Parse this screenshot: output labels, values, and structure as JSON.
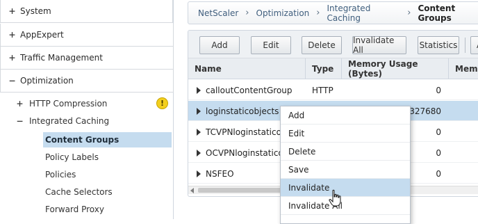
{
  "sidebar": {
    "top_items": [
      {
        "label": "System",
        "state": "+"
      },
      {
        "label": "AppExpert",
        "state": "+"
      },
      {
        "label": "Traffic Management",
        "state": "+"
      },
      {
        "label": "Optimization",
        "state": "−"
      }
    ],
    "sub_items": [
      {
        "label": "HTTP Compression",
        "state": "+"
      },
      {
        "label": "Integrated Caching",
        "state": "−"
      }
    ],
    "leaf_items": [
      {
        "label": "Content Groups"
      },
      {
        "label": "Policy Labels"
      },
      {
        "label": "Policies"
      },
      {
        "label": "Cache Selectors"
      },
      {
        "label": "Forward Proxy"
      }
    ],
    "warning_glyph": "!"
  },
  "breadcrumb": {
    "items": [
      "NetScaler",
      "Optimization",
      "Integrated Caching",
      "Content Groups"
    ],
    "separator": "›"
  },
  "toolbar": {
    "buttons": [
      "Add",
      "Edit",
      "Delete",
      "Invalidate All",
      "Statistics",
      "A"
    ]
  },
  "table": {
    "columns": [
      "Name",
      "Type",
      "Memory Usage (Bytes)",
      "Memo"
    ],
    "rows": [
      {
        "name": "calloutContentGroup",
        "type": "HTTP",
        "memory": "0"
      },
      {
        "name": "loginstaticobjects",
        "type": "",
        "memory": "327680"
      },
      {
        "name": "TCVPNloginstaticobj",
        "type": "",
        "memory": "0"
      },
      {
        "name": "OCVPNloginstaticob",
        "type": "",
        "memory": "0"
      },
      {
        "name": "NSFEO",
        "type": "",
        "memory": "0"
      }
    ]
  },
  "context_menu": {
    "items": [
      "Add",
      "Edit",
      "Delete",
      "Save",
      "Invalidate",
      "Invalidate All"
    ]
  },
  "colors": {
    "selection": "#c5dcef",
    "warning": "#f3cf1e",
    "link": "#3f5e7d"
  }
}
